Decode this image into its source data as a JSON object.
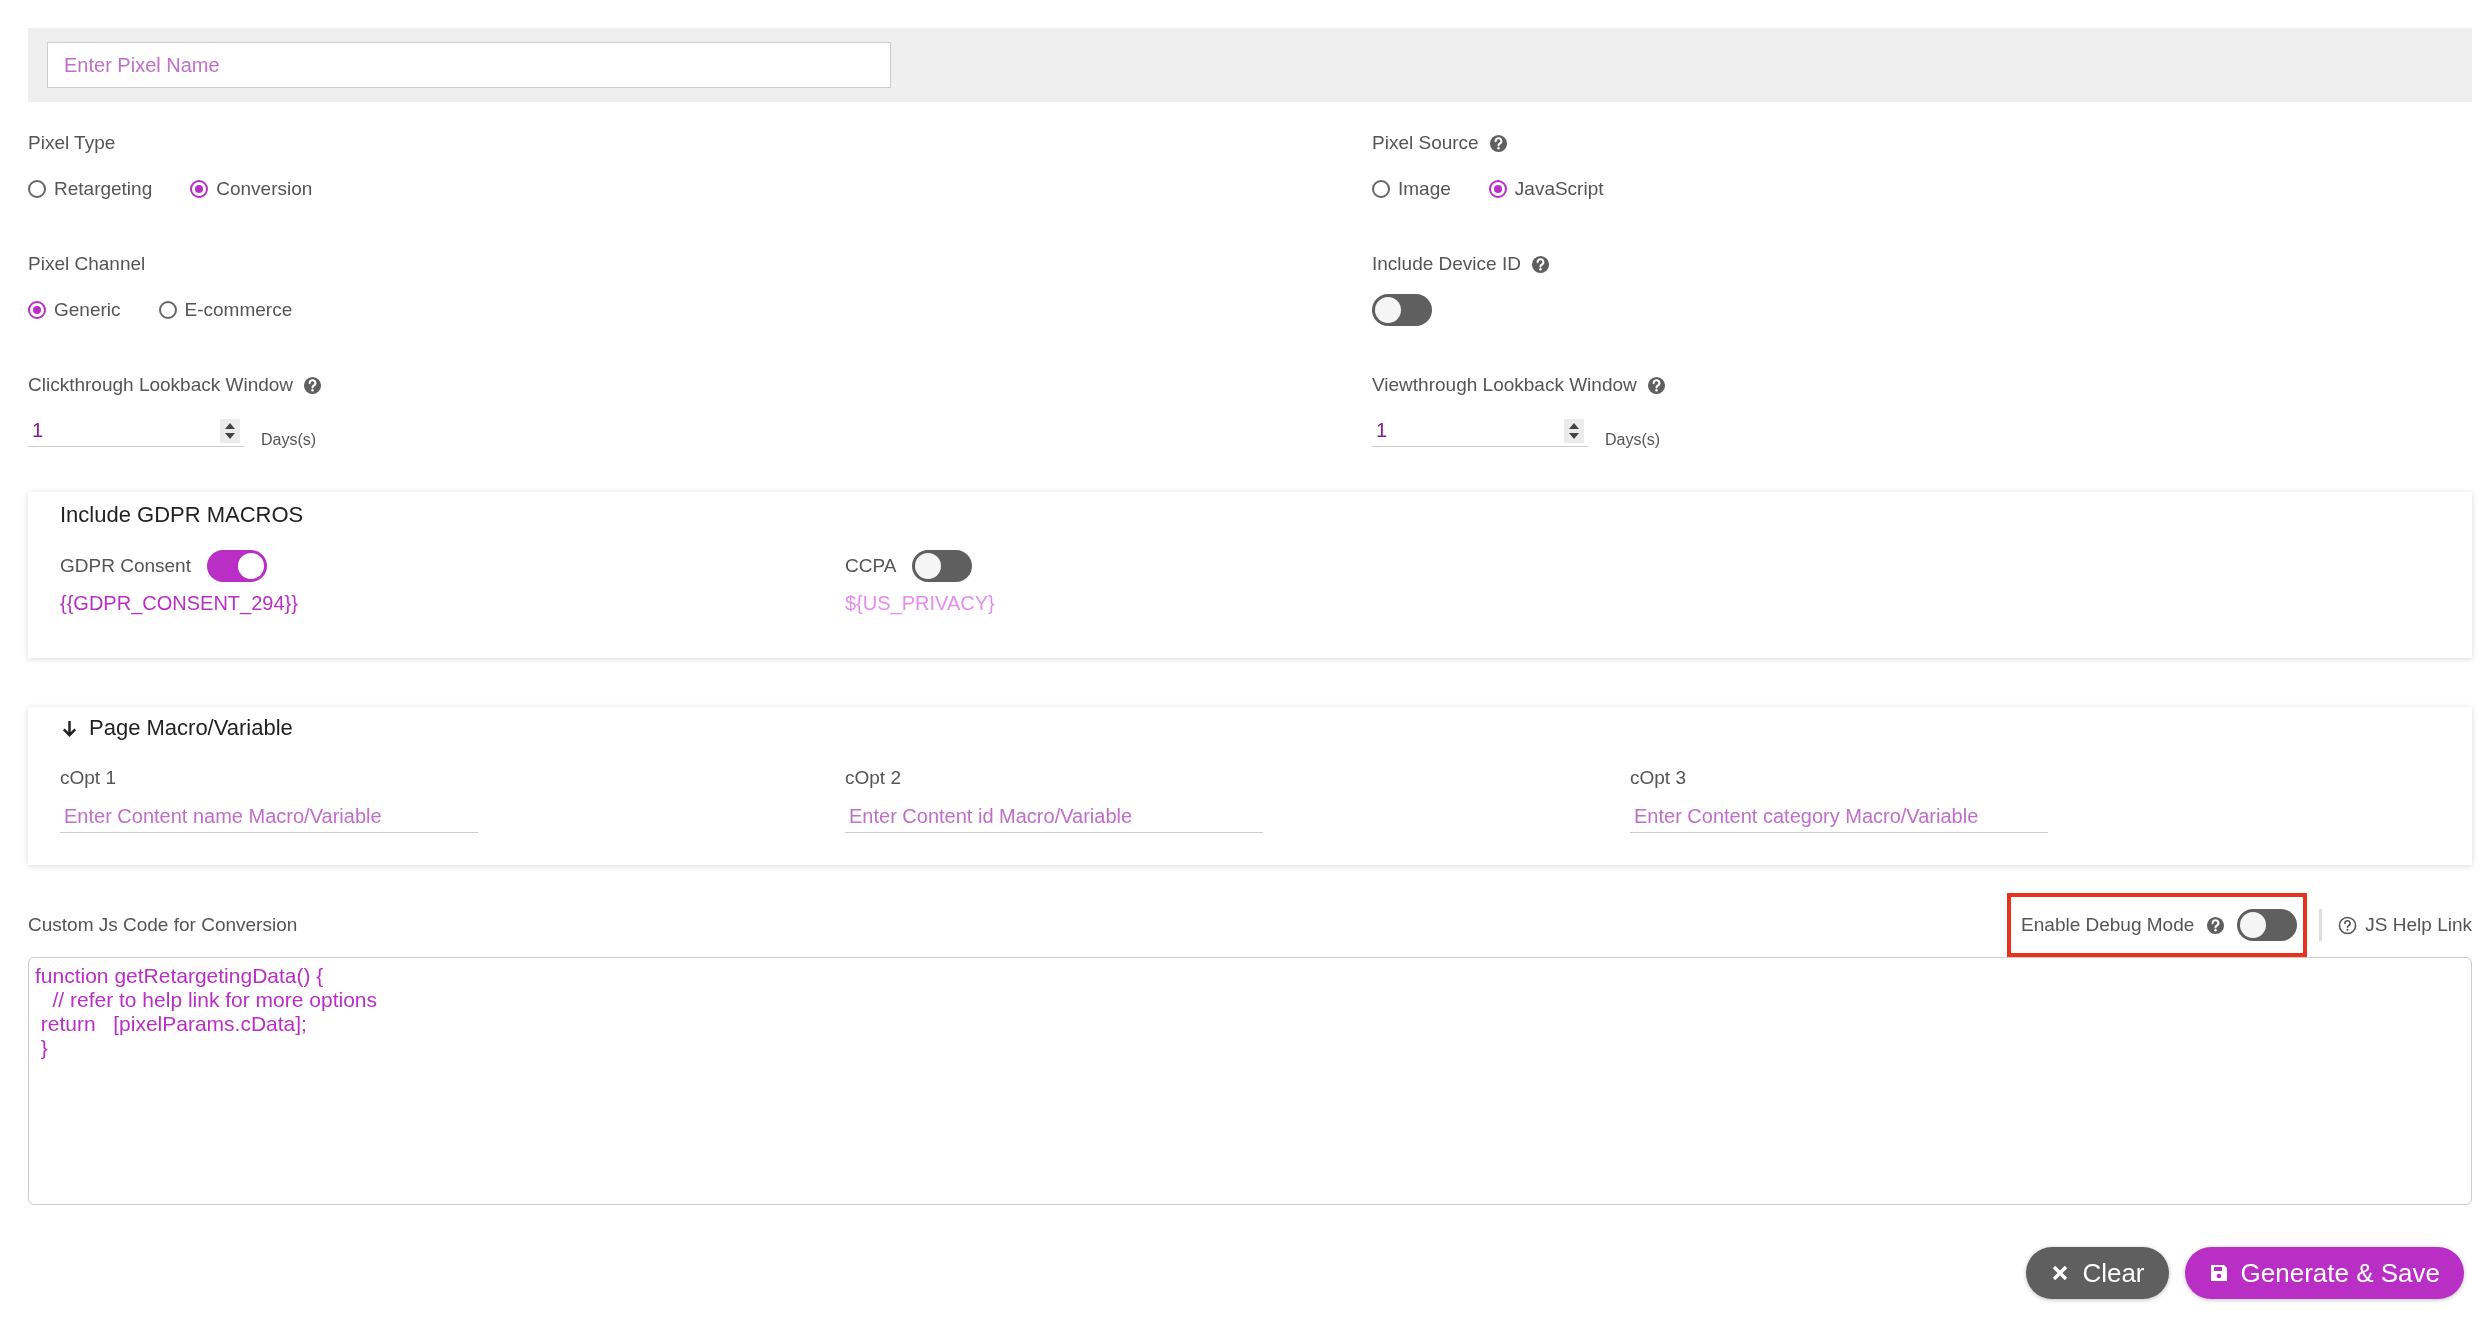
{
  "pixel_name": {
    "placeholder": "Enter Pixel Name"
  },
  "fields": [
    {
      "kind": "radio",
      "label": "Pixel Type",
      "help": false,
      "options": [
        {
          "label": "Retargeting",
          "selected": false
        },
        {
          "label": "Conversion",
          "selected": true
        }
      ]
    },
    {
      "kind": "radio",
      "label": "Pixel Source",
      "help": true,
      "options": [
        {
          "label": "Image",
          "selected": false
        },
        {
          "label": "JavaScript",
          "selected": true
        }
      ]
    },
    {
      "kind": "radio",
      "label": "Pixel Channel",
      "help": false,
      "options": [
        {
          "label": "Generic",
          "selected": true
        },
        {
          "label": "E-commerce",
          "selected": false
        }
      ]
    },
    {
      "kind": "toggle",
      "label": "Include Device ID",
      "help": true,
      "on": false
    },
    {
      "kind": "number",
      "label": "Clickthrough Lookback Window",
      "help": true,
      "value": "1",
      "unit": "Days(s)"
    },
    {
      "kind": "number",
      "label": "Viewthrough Lookback Window",
      "help": true,
      "value": "1",
      "unit": "Days(s)"
    }
  ],
  "gdpr": {
    "title": "Include GDPR MACROS",
    "items": [
      {
        "label": "GDPR Consent",
        "on": true,
        "macro": "{{GDPR_CONSENT_294}}"
      },
      {
        "label": "CCPA",
        "on": false,
        "macro": "${US_PRIVACY}"
      }
    ]
  },
  "page_macros": {
    "title": "Page Macro/Variable",
    "fields": [
      {
        "label": "cOpt 1",
        "placeholder": "Enter Content name Macro/Variable"
      },
      {
        "label": "cOpt 2",
        "placeholder": "Enter Content id Macro/Variable"
      },
      {
        "label": "cOpt 3",
        "placeholder": "Enter Content category Macro/Variable"
      }
    ]
  },
  "custom_code": {
    "label": "Custom Js Code for Conversion",
    "debug": {
      "label": "Enable Debug Mode",
      "on": false,
      "highlighted": true
    },
    "help_link": "JS Help Link",
    "code": "function getRetargetingData() {\n   // refer to help link for more options\n return   [pixelParams.cData];\n }"
  },
  "buttons": [
    {
      "kind": "secondary",
      "label": "Clear"
    },
    {
      "kind": "primary",
      "label": "Generate & Save"
    }
  ]
}
